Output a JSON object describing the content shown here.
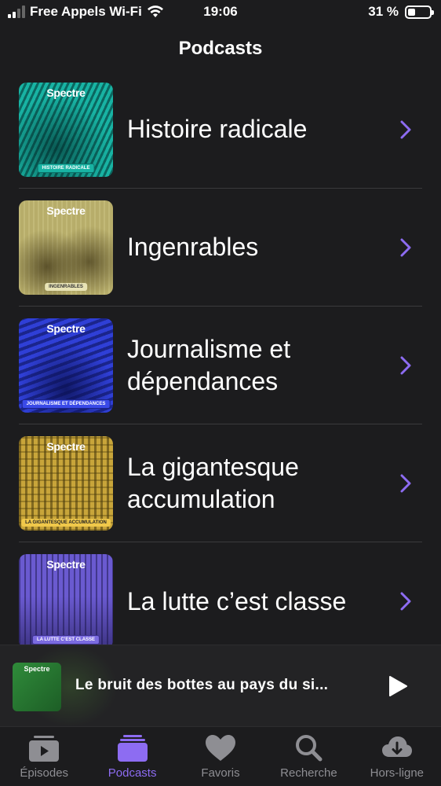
{
  "status_bar": {
    "carrier": "Free Appels Wi-Fi",
    "time": "19:06",
    "battery_percent": "31 %",
    "battery_level": 0.31,
    "signal_bars": 2
  },
  "nav": {
    "title": "Podcasts"
  },
  "accent_color": "#8d6cf2",
  "podcasts": [
    {
      "title": "Histoire radicale",
      "brand": "Spectre",
      "tag": "HISTOIRE RADICALE",
      "color": "#18b3a3"
    },
    {
      "title": "Ingenrables",
      "brand": "Spectre",
      "tag": "INGENRABLES",
      "color": "#b7ad6a"
    },
    {
      "title": "Journalisme et dépendances",
      "brand": "Spectre",
      "tag": "JOURNALISME ET DÉPENDANCES",
      "color": "#2f3fd6"
    },
    {
      "title": "La gigantesque accumulation",
      "brand": "Spectre",
      "tag": "LA GIGANTESQUE ACCUMULATION",
      "color": "#c8a53a"
    },
    {
      "title": "La lutte c’est classe",
      "brand": "Spectre",
      "tag": "LA LUTTE C’EST CLASSE",
      "color": "#6a5ad0"
    }
  ],
  "mini_player": {
    "brand": "Spectre",
    "title": "Le bruit des bottes au pays du si..."
  },
  "tabs": [
    {
      "label": "Épisodes",
      "icon": "episodes-icon",
      "active": false
    },
    {
      "label": "Podcasts",
      "icon": "podcasts-icon",
      "active": true
    },
    {
      "label": "Favoris",
      "icon": "heart-icon",
      "active": false
    },
    {
      "label": "Recherche",
      "icon": "search-icon",
      "active": false
    },
    {
      "label": "Hors-ligne",
      "icon": "download-icon",
      "active": false
    }
  ]
}
